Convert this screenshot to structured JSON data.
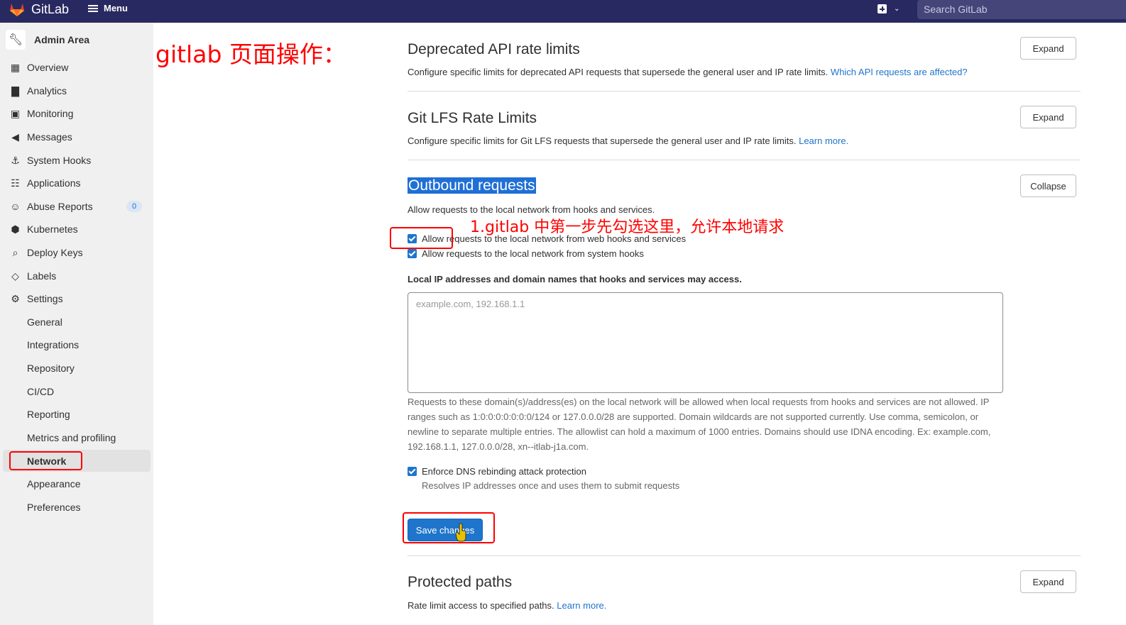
{
  "topbar": {
    "logo_text": "GitLab",
    "menu_label": "Menu",
    "search_placeholder": "Search GitLab"
  },
  "sidebar": {
    "title": "Admin Area",
    "items": [
      {
        "label": "Overview",
        "icon": "overview-icon"
      },
      {
        "label": "Analytics",
        "icon": "analytics-icon"
      },
      {
        "label": "Monitoring",
        "icon": "monitoring-icon"
      },
      {
        "label": "Messages",
        "icon": "messages-icon"
      },
      {
        "label": "System Hooks",
        "icon": "hooks-icon"
      },
      {
        "label": "Applications",
        "icon": "applications-icon"
      },
      {
        "label": "Abuse Reports",
        "icon": "abuse-icon",
        "badge": "0"
      },
      {
        "label": "Kubernetes",
        "icon": "kubernetes-icon"
      },
      {
        "label": "Deploy Keys",
        "icon": "key-icon"
      },
      {
        "label": "Labels",
        "icon": "label-icon"
      },
      {
        "label": "Settings",
        "icon": "gear-icon"
      }
    ],
    "settings_sub": [
      "General",
      "Integrations",
      "Repository",
      "CI/CD",
      "Reporting",
      "Metrics and profiling",
      "Network",
      "Appearance",
      "Preferences"
    ],
    "active": "Network"
  },
  "annotations": {
    "title": "gitlab 页面操作：",
    "step1": "1.gitlab 中第一步先勾选这里，允许本地请求"
  },
  "sections": {
    "deprecated": {
      "title": "Deprecated API rate limits",
      "desc": "Configure specific limits for deprecated API requests that supersede the general user and IP rate limits.",
      "link": "Which API requests are affected?",
      "button": "Expand"
    },
    "lfs": {
      "title": "Git LFS Rate Limits",
      "desc": "Configure specific limits for Git LFS requests that supersede the general user and IP rate limits.",
      "link": "Learn more.",
      "button": "Expand"
    },
    "outbound": {
      "title": "Outbound requests",
      "desc": "Allow requests to the local network from hooks and services.",
      "button": "Collapse",
      "cb1": "Allow requests to the local network from web hooks and services",
      "cb2": "Allow requests to the local network from system hooks",
      "field_label": "Local IP addresses and domain names that hooks and services may access.",
      "field_placeholder": "example.com, 192.168.1.1",
      "help": "Requests to these domain(s)/address(es) on the local network will be allowed when local requests from hooks and services are not allowed. IP ranges such as 1:0:0:0:0:0:0:0/124 or 127.0.0.0/28 are supported. Domain wildcards are not supported currently. Use comma, semicolon, or newline to separate multiple entries. The allowlist can hold a maximum of 1000 entries. Domains should use IDNA encoding. Ex: example.com, 192.168.1.1, 127.0.0.0/28, xn--itlab-j1a.com.",
      "cb3": "Enforce DNS rebinding attack protection",
      "cb3_help": "Resolves IP addresses once and uses them to submit requests",
      "save": "Save changes"
    },
    "protected": {
      "title": "Protected paths",
      "desc": "Rate limit access to specified paths.",
      "link": "Learn more.",
      "button": "Expand"
    }
  },
  "colors": {
    "topbar": "#292961",
    "primary": "#1f75cb",
    "annotation": "#ff0000"
  }
}
